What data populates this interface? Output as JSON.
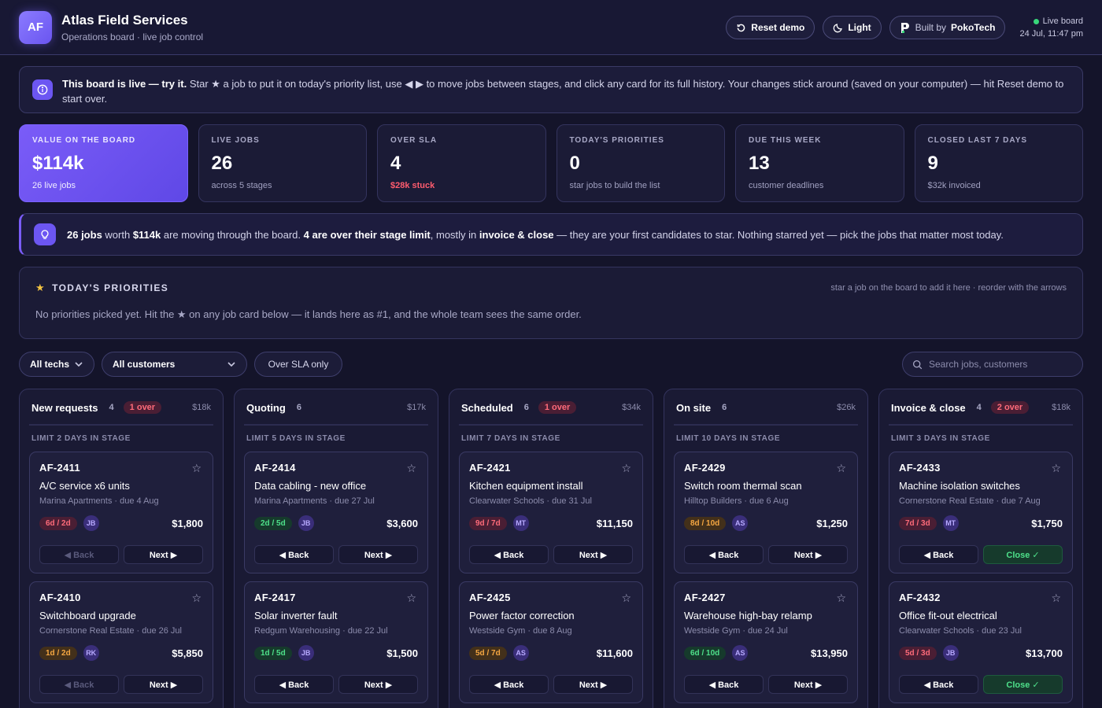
{
  "header": {
    "logo": "AF",
    "title": "Atlas Field Services",
    "subtitle": "Operations board · live job control",
    "reset_label": "Reset demo",
    "theme_label": "Light",
    "built_by_prefix": "Built by",
    "built_by_name": "PokoTech",
    "live_label": "Live board",
    "datetime": "24 Jul, 11:47 pm"
  },
  "info": {
    "lead": "This board is live — try it.",
    "text": " Star ★ a job to put it on today's priority list, use ◀ ▶ to move jobs between stages, and click any card for its full history. Your changes stick around (saved on your computer) — hit Reset demo to start over."
  },
  "kpis": [
    {
      "label": "VALUE ON THE BOARD",
      "value": "$114k",
      "sub": "26 live jobs"
    },
    {
      "label": "LIVE JOBS",
      "value": "26",
      "sub": "across 5 stages"
    },
    {
      "label": "OVER SLA",
      "value": "4",
      "sub": "$28k stuck"
    },
    {
      "label": "TODAY'S PRIORITIES",
      "value": "0",
      "sub": "star jobs to build the list"
    },
    {
      "label": "DUE THIS WEEK",
      "value": "13",
      "sub": "customer deadlines"
    },
    {
      "label": "CLOSED LAST 7 DAYS",
      "value": "9",
      "sub": "$32k invoiced"
    }
  ],
  "summary": {
    "b1": "26 jobs",
    "t1": " worth ",
    "b2": "$114k",
    "t2": " are moving through the board. ",
    "b3": "4 are over their stage limit",
    "t3": ", mostly in ",
    "b4": "invoice & close",
    "t4": " — they are your first candidates to star. Nothing starred yet — pick the jobs that matter most today."
  },
  "priorities": {
    "title": "TODAY'S PRIORITIES",
    "hint": "star a job on the board to add it here · reorder with the arrows",
    "empty": "No priorities picked yet. Hit the ★ on any job card below — it lands here as #1, and the whole team sees the same order."
  },
  "filters": {
    "techs": "All techs",
    "customers": "All customers",
    "over_sla": "Over SLA only",
    "search_placeholder": "Search jobs, customers"
  },
  "columns": [
    {
      "name": "New requests",
      "count": "4",
      "over": "1 over",
      "value": "$18k",
      "limit": "LIMIT 2 DAYS IN STAGE",
      "cards": [
        {
          "id": "AF-2411",
          "title": "A/C service x6 units",
          "meta": "Marina Apartments · due 4 Aug",
          "age": "6d / 2d",
          "age_tone": "red",
          "tech": "JB",
          "amount": "$1,800",
          "back": "◀ Back",
          "next": "Next ▶"
        },
        {
          "id": "AF-2410",
          "title": "Switchboard upgrade",
          "meta": "Cornerstone Real Estate · due 26 Jul",
          "age": "1d / 2d",
          "age_tone": "orange",
          "tech": "RK",
          "amount": "$5,850",
          "back": "◀ Back",
          "next": "Next ▶"
        }
      ]
    },
    {
      "name": "Quoting",
      "count": "6",
      "over": "",
      "value": "$17k",
      "limit": "LIMIT 5 DAYS IN STAGE",
      "cards": [
        {
          "id": "AF-2414",
          "title": "Data cabling - new office",
          "meta": "Marina Apartments · due 27 Jul",
          "age": "2d / 5d",
          "age_tone": "green",
          "tech": "JB",
          "amount": "$3,600",
          "back": "◀ Back",
          "next": "Next ▶"
        },
        {
          "id": "AF-2417",
          "title": "Solar inverter fault",
          "meta": "Redgum Warehousing · due 22 Jul",
          "age": "1d / 5d",
          "age_tone": "green",
          "tech": "JB",
          "amount": "$1,500",
          "back": "◀ Back",
          "next": "Next ▶"
        }
      ]
    },
    {
      "name": "Scheduled",
      "count": "6",
      "over": "1 over",
      "value": "$34k",
      "limit": "LIMIT 7 DAYS IN STAGE",
      "cards": [
        {
          "id": "AF-2421",
          "title": "Kitchen equipment install",
          "meta": "Clearwater Schools · due 31 Jul",
          "age": "9d / 7d",
          "age_tone": "red",
          "tech": "MT",
          "amount": "$11,150",
          "back": "◀ Back",
          "next": "Next ▶"
        },
        {
          "id": "AF-2425",
          "title": "Power factor correction",
          "meta": "Westside Gym · due 8 Aug",
          "age": "5d / 7d",
          "age_tone": "orange",
          "tech": "AS",
          "amount": "$11,600",
          "back": "◀ Back",
          "next": "Next ▶"
        }
      ]
    },
    {
      "name": "On site",
      "count": "6",
      "over": "",
      "value": "$26k",
      "limit": "LIMIT 10 DAYS IN STAGE",
      "cards": [
        {
          "id": "AF-2429",
          "title": "Switch room thermal scan",
          "meta": "Hilltop Builders · due 6 Aug",
          "age": "8d / 10d",
          "age_tone": "orange",
          "tech": "AS",
          "amount": "$1,250",
          "back": "◀ Back",
          "next": "Next ▶"
        },
        {
          "id": "AF-2427",
          "title": "Warehouse high-bay relamp",
          "meta": "Westside Gym · due 24 Jul",
          "age": "6d / 10d",
          "age_tone": "green",
          "tech": "AS",
          "amount": "$13,950",
          "back": "◀ Back",
          "next": "Next ▶"
        }
      ]
    },
    {
      "name": "Invoice & close",
      "count": "4",
      "over": "2 over",
      "value": "$18k",
      "limit": "LIMIT 3 DAYS IN STAGE",
      "cards": [
        {
          "id": "AF-2433",
          "title": "Machine isolation switches",
          "meta": "Cornerstone Real Estate · due 7 Aug",
          "age": "7d / 3d",
          "age_tone": "red",
          "tech": "MT",
          "amount": "$1,750",
          "back": "◀ Back",
          "next": "Close ✓"
        },
        {
          "id": "AF-2432",
          "title": "Office fit-out electrical",
          "meta": "Clearwater Schools · due 23 Jul",
          "age": "5d / 3d",
          "age_tone": "red",
          "tech": "JB",
          "amount": "$13,700",
          "back": "◀ Back",
          "next": "Close ✓"
        }
      ]
    }
  ]
}
